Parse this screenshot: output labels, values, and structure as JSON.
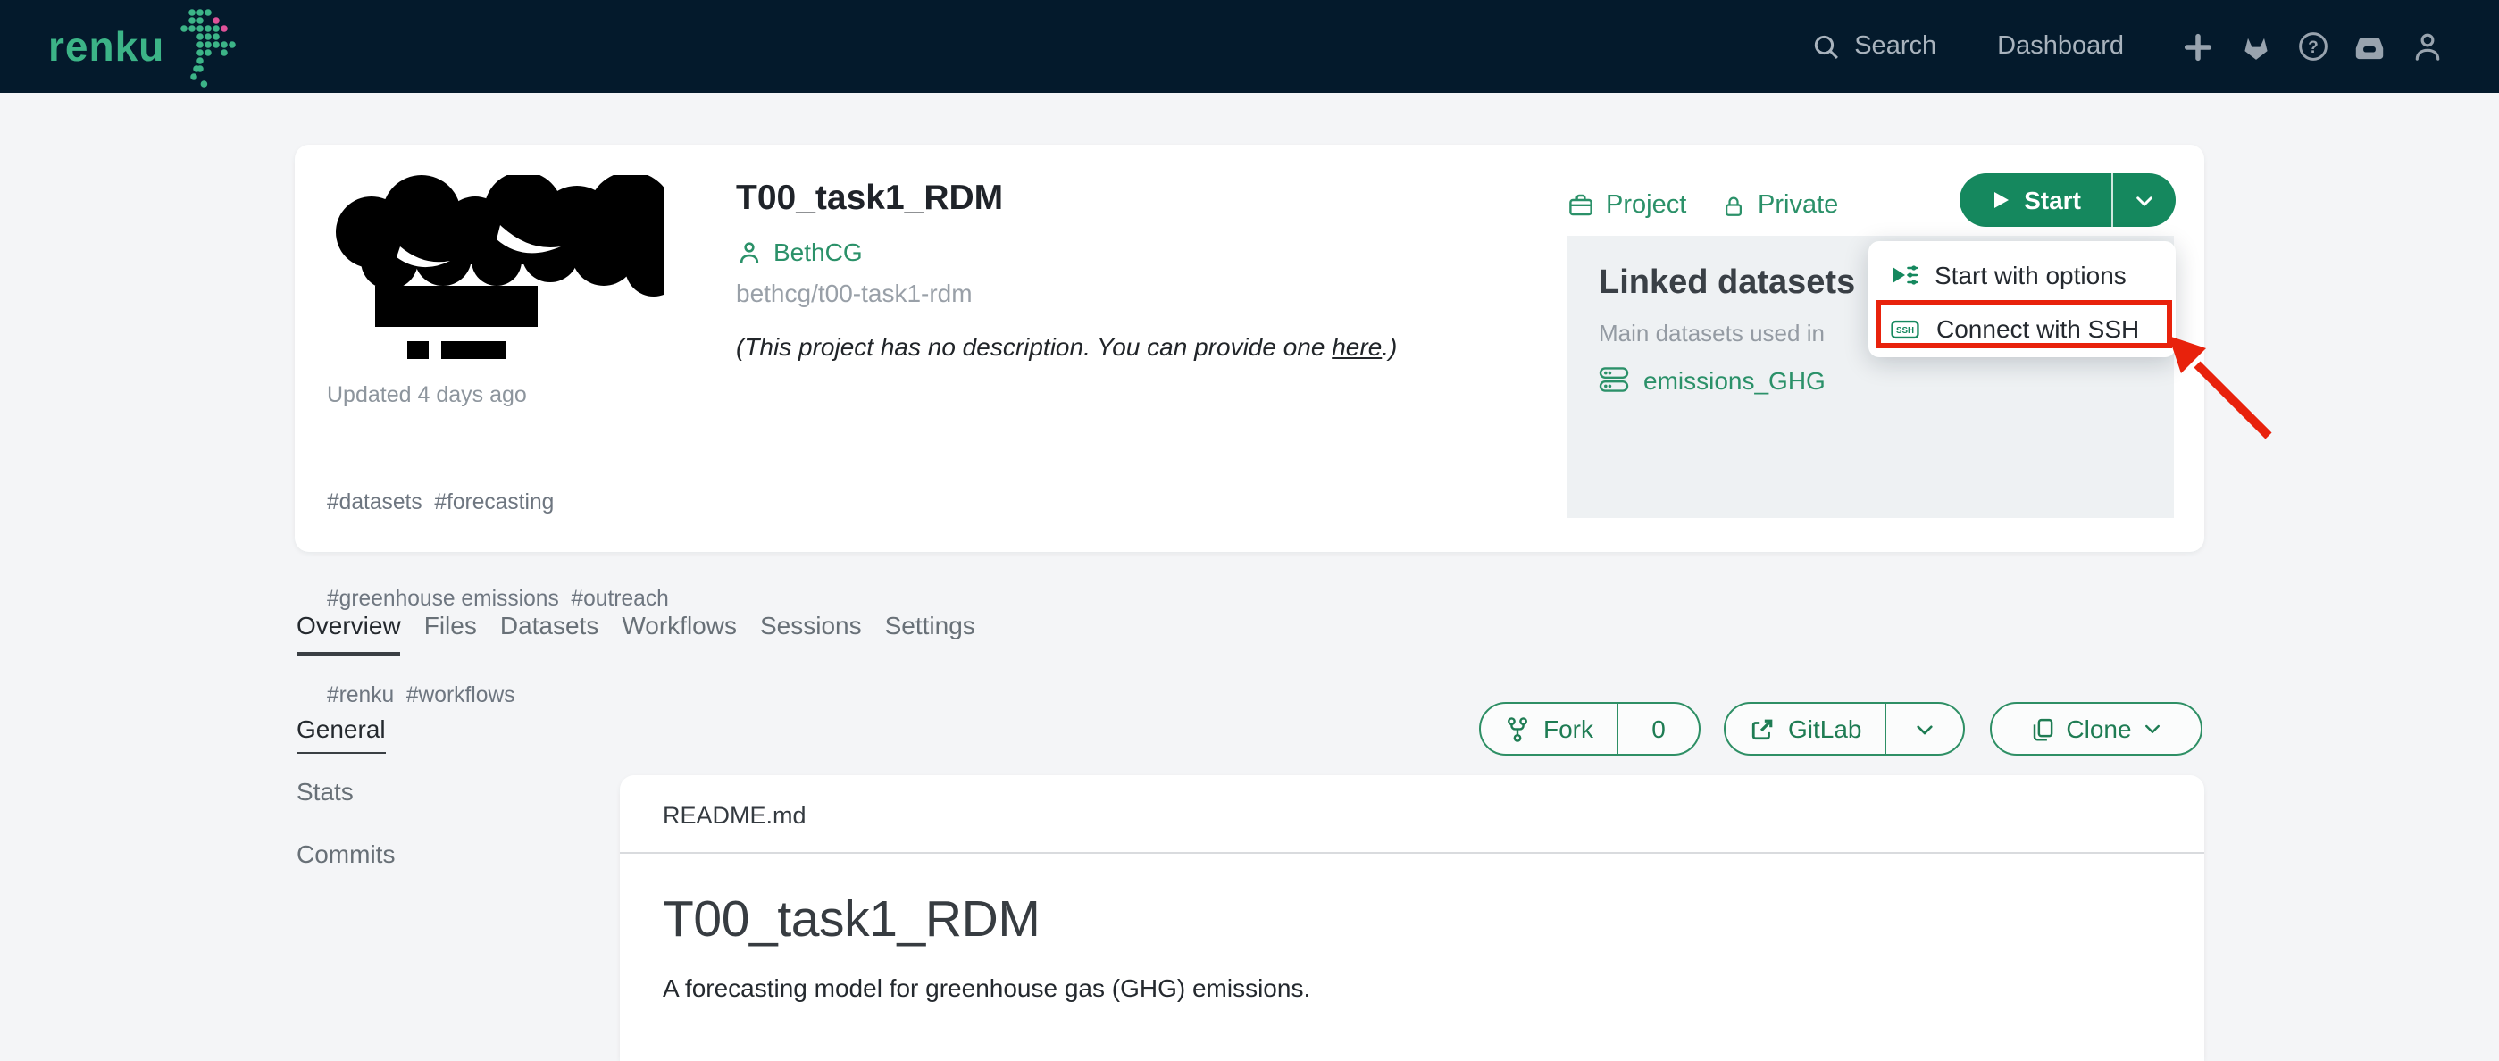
{
  "navbar": {
    "brand": "renku",
    "search_label": "Search",
    "dashboard_label": "Dashboard",
    "help_glyph": "?"
  },
  "project": {
    "title": "T00_task1_RDM",
    "author": "BethCG",
    "slug": "bethcg/t00-task1-rdm",
    "updated": "Updated 4 days ago",
    "description": {
      "prefix": "(This project has no description. You can provide one ",
      "link_text": "here",
      "suffix": ".)"
    },
    "tags": [
      "#datasets  #forecasting",
      "#greenhouse emissions  #outreach",
      "#renku  #workflows"
    ],
    "type_label": "Project",
    "visibility_label": "Private"
  },
  "start": {
    "label": "Start",
    "menu": {
      "option1": "Start with options",
      "option2": "Connect with SSH",
      "ssh_badge": "SSH"
    }
  },
  "linked_datasets": {
    "title": "Linked datasets",
    "subtitle": "Main datasets used in",
    "dataset": "emissions_GHG"
  },
  "tabs": [
    "Overview",
    "Files",
    "Datasets",
    "Workflows",
    "Sessions",
    "Settings"
  ],
  "subnav": [
    "General",
    "Stats",
    "Commits"
  ],
  "actions": {
    "fork_label": "Fork",
    "fork_count": "0",
    "gitlab_label": "GitLab",
    "clone_label": "Clone"
  },
  "readme": {
    "filename": "README.md",
    "heading": "T00_task1_RDM",
    "body": "A forecasting model for greenhouse gas (GHG) emissions."
  },
  "colors": {
    "navbar_bg": "#041a2c",
    "accent_green": "#15885e",
    "link_green": "#2b9169",
    "highlight_red": "#e8220c"
  }
}
